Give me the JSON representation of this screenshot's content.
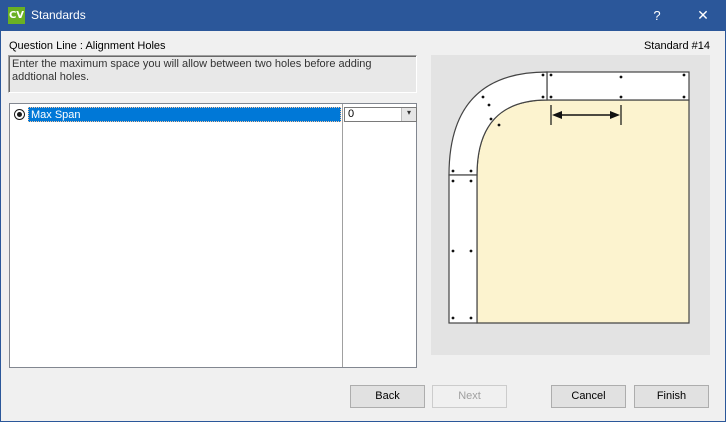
{
  "window": {
    "app_icon_text": "CV",
    "title": "Standards",
    "help_glyph": "?",
    "close_glyph": "✕"
  },
  "header": {
    "question_line": "Question Line : Alignment Holes",
    "standard_number": "Standard #14"
  },
  "description": "Enter the maximum space you will allow between two holes before adding addtional holes.",
  "grid": {
    "rows": [
      {
        "label": "Max Span",
        "value": "0",
        "selected": true
      }
    ],
    "dropdown_glyph": "▾"
  },
  "diagram": {
    "icon": "alignment-holes-corner-diagram",
    "colors": {
      "background": "#e3e3e3",
      "panel": "#fcf3cf",
      "strip": "#ffffff",
      "outline": "#444444"
    }
  },
  "buttons": {
    "back": "Back",
    "next": "Next",
    "cancel": "Cancel",
    "finish": "Finish"
  }
}
